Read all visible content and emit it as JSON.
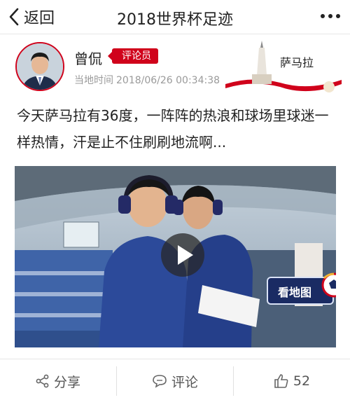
{
  "nav": {
    "back_label": "返回",
    "title": "2018世界杯足迹"
  },
  "post": {
    "author": "曾侃",
    "role": "评论员",
    "time_label": "当地时间",
    "time": "2018/06/26 00:34:38",
    "city": "萨马拉",
    "text": "今天萨马拉有36度，一阵阵的热浪和球场里球迷一样热情，汗是止不住刷刷地流啊..."
  },
  "video": {
    "map_label": "看地图"
  },
  "actions": {
    "share_label": "分享",
    "comment_label": "评论",
    "like_count": "52"
  },
  "colors": {
    "accent": "#d0021b",
    "badge_navy": "#1a2b63"
  }
}
